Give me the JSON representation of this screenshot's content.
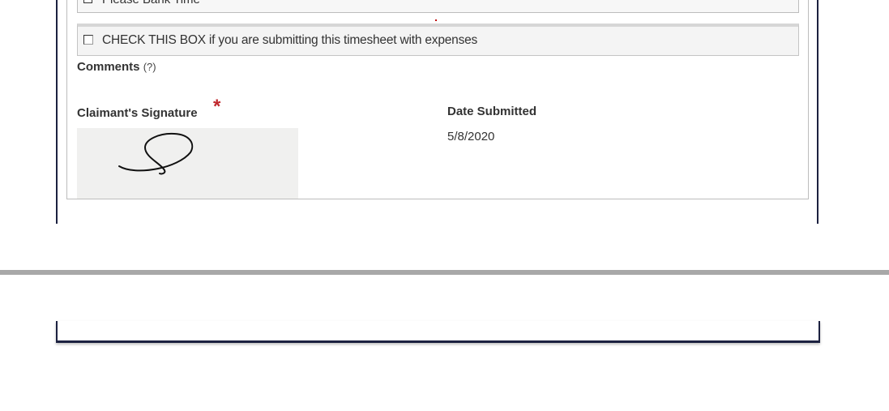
{
  "form": {
    "prev_checkbox_label": "Please Bank Time",
    "expenses_checkbox_label": "CHECK THIS BOX if you are submitting this timesheet with expenses",
    "comments_label": "Comments",
    "comments_help": "(?)",
    "signature_label": "Claimant's Signature",
    "required_marker": "*",
    "date_submitted_label": "Date Submitted",
    "date_submitted_value": "5/8/2020",
    "expenses_checked": false
  },
  "colors": {
    "frame_border": "#1c2140",
    "required_star": "#c0282d",
    "signature_pad_bg": "#f0f0ef",
    "divider": "#a8a8a8"
  }
}
